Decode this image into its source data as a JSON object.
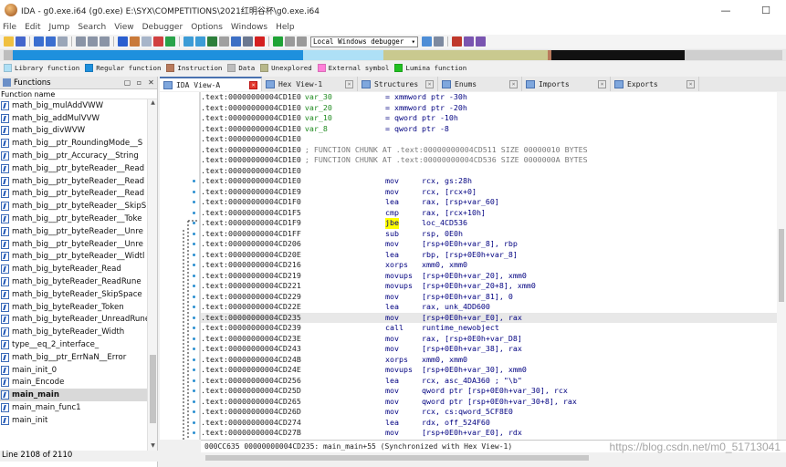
{
  "window": {
    "title": "IDA - g0.exe.i64 (g0.exe) E:\\SYX\\COMPETITIONS\\2021红明谷杯\\g0.exe.i64",
    "minimize": "—",
    "maximize": "☐"
  },
  "menu": [
    "File",
    "Edit",
    "Jump",
    "Search",
    "View",
    "Debugger",
    "Options",
    "Windows",
    "Help"
  ],
  "toolbar": {
    "debugger_select": "Local Windows debugger",
    "debugger_arrow": "▾"
  },
  "legend": [
    {
      "label": "Library function",
      "color": "#aee0f6"
    },
    {
      "label": "Regular function",
      "color": "#1e90dd"
    },
    {
      "label": "Instruction",
      "color": "#b87a5c"
    },
    {
      "label": "Data",
      "color": "#bdbdbd"
    },
    {
      "label": "Unexplored",
      "color": "#b8b88a"
    },
    {
      "label": "External symbol",
      "color": "#ff7fd8"
    },
    {
      "label": "Lumina function",
      "color": "#22c022"
    }
  ],
  "functions_panel": {
    "title": "Functions",
    "buttons": [
      "▢",
      "▫",
      "✕"
    ],
    "column_header": "Function name",
    "items": [
      "math_big_mulAddVWW",
      "math_big_addMulVVW",
      "math_big_divWVW",
      "math_big__ptr_RoundingMode__S",
      "math_big__ptr_Accuracy__String",
      "math_big__ptr_byteReader__Read",
      "math_big__ptr_byteReader__Read",
      "math_big__ptr_byteReader__Read",
      "math_big__ptr_byteReader__SkipS",
      "math_big__ptr_byteReader__Toke",
      "math_big__ptr_byteReader__Unre",
      "math_big__ptr_byteReader__Unre",
      "math_big__ptr_byteReader__Widtl",
      "math_big_byteReader_Read",
      "math_big_byteReader_ReadRune",
      "math_big_byteReader_SkipSpace",
      "math_big_byteReader_Token",
      "math_big_byteReader_UnreadRune",
      "math_big_byteReader_Width",
      "type__eq_2_interface_",
      "math_big__ptr_ErrNaN__Error",
      "main_init_0",
      "main_Encode",
      "main_main",
      "main_main_func1",
      "main_init"
    ],
    "selected_index": 23,
    "status": "Line 2108 of 2110"
  },
  "tabs": [
    {
      "label": "IDA View-A",
      "active": true
    },
    {
      "label": "Hex View-1",
      "active": false
    },
    {
      "label": "Structures",
      "active": false
    },
    {
      "label": "Enums",
      "active": false
    },
    {
      "label": "Imports",
      "active": false
    },
    {
      "label": "Exports",
      "active": false
    }
  ],
  "disasm": [
    {
      "addr": ".text:00000000004CD1E0",
      "a": "var_30",
      "b": "= xmmword ptr -30h"
    },
    {
      "addr": ".text:00000000004CD1E0",
      "a": "var_20",
      "b": "= xmmword ptr -20h"
    },
    {
      "addr": ".text:00000000004CD1E0",
      "a": "var_10",
      "b": "= qword ptr -10h"
    },
    {
      "addr": ".text:00000000004CD1E0",
      "a": "var_8",
      "b": "= qword ptr -8"
    },
    {
      "addr": ".text:00000000004CD1E0",
      "a": "",
      "b": ""
    },
    {
      "addr": ".text:00000000004CD1E0",
      "a": "; FUNCTION CHUNK AT .text:00000000004CD511 SIZE 00000010 BYTES",
      "b": ""
    },
    {
      "addr": ".text:00000000004CD1E0",
      "a": "; FUNCTION CHUNK AT .text:00000000004CD536 SIZE 0000000A BYTES",
      "b": ""
    },
    {
      "addr": ".text:00000000004CD1E0",
      "a": "",
      "b": ""
    },
    {
      "addr": ".text:00000000004CD1E0",
      "mn": "mov",
      "op": "rcx, gs:28h"
    },
    {
      "addr": ".text:00000000004CD1E9",
      "mn": "mov",
      "op": "rcx, [rcx+0]"
    },
    {
      "addr": ".text:00000000004CD1F0",
      "mn": "lea",
      "op": "rax, [rsp+var_60]"
    },
    {
      "addr": ".text:00000000004CD1F5",
      "mn": "cmp",
      "op": "rax, [rcx+10h]"
    },
    {
      "addr": ".text:00000000004CD1F9",
      "mn": "jbe",
      "op": "loc_4CD536"
    },
    {
      "addr": ".text:00000000004CD1FF",
      "mn": "sub",
      "op": "rsp, 0E0h"
    },
    {
      "addr": ".text:00000000004CD206",
      "mn": "mov",
      "op": "[rsp+0E0h+var_8], rbp"
    },
    {
      "addr": ".text:00000000004CD20E",
      "mn": "lea",
      "op": "rbp, [rsp+0E0h+var_8]"
    },
    {
      "addr": ".text:00000000004CD216",
      "mn": "xorps",
      "op": "xmm0, xmm0"
    },
    {
      "addr": ".text:00000000004CD219",
      "mn": "movups",
      "op": "[rsp+0E0h+var_20], xmm0"
    },
    {
      "addr": ".text:00000000004CD221",
      "mn": "movups",
      "op": "[rsp+0E0h+var_20+8], xmm0"
    },
    {
      "addr": ".text:00000000004CD229",
      "mn": "mov",
      "op": "[rsp+0E0h+var_81], 0"
    },
    {
      "addr": ".text:00000000004CD22E",
      "mn": "lea",
      "op": "rax, unk_4DD600"
    },
    {
      "addr": ".text:00000000004CD235",
      "mn": "mov",
      "op": "[rsp+0E0h+var_E0], rax"
    },
    {
      "addr": ".text:00000000004CD239",
      "mn": "call",
      "op": "runtime_newobject"
    },
    {
      "addr": ".text:00000000004CD23E",
      "mn": "mov",
      "op": "rax, [rsp+0E0h+var_D8]"
    },
    {
      "addr": ".text:00000000004CD243",
      "mn": "mov",
      "op": "[rsp+0E0h+var_38], rax"
    },
    {
      "addr": ".text:00000000004CD24B",
      "mn": "xorps",
      "op": "xmm0, xmm0"
    },
    {
      "addr": ".text:00000000004CD24E",
      "mn": "movups",
      "op": "[rsp+0E0h+var_30], xmm0"
    },
    {
      "addr": ".text:00000000004CD256",
      "mn": "lea",
      "op": "rcx, asc_4DA360 ; \"\\b\""
    },
    {
      "addr": ".text:00000000004CD25D",
      "mn": "mov",
      "op": "qword ptr [rsp+0E0h+var_30], rcx"
    },
    {
      "addr": ".text:00000000004CD265",
      "mn": "mov",
      "op": "qword ptr [rsp+0E0h+var_30+8], rax"
    },
    {
      "addr": ".text:00000000004CD26D",
      "mn": "mov",
      "op": "rcx, cs:qword_5CF8E0"
    },
    {
      "addr": ".text:00000000004CD274",
      "mn": "lea",
      "op": "rdx, off_524F60"
    },
    {
      "addr": ".text:00000000004CD27B",
      "mn": "mov",
      "op": "[rsp+0E0h+var_E0], rdx"
    }
  ],
  "disasm_highlight_index": 21,
  "sync_status": "000CC635 00000000004CD235: main_main+55 (Synchronized with Hex View-1)",
  "watermark": "https://blog.csdn.net/m0_51713041"
}
